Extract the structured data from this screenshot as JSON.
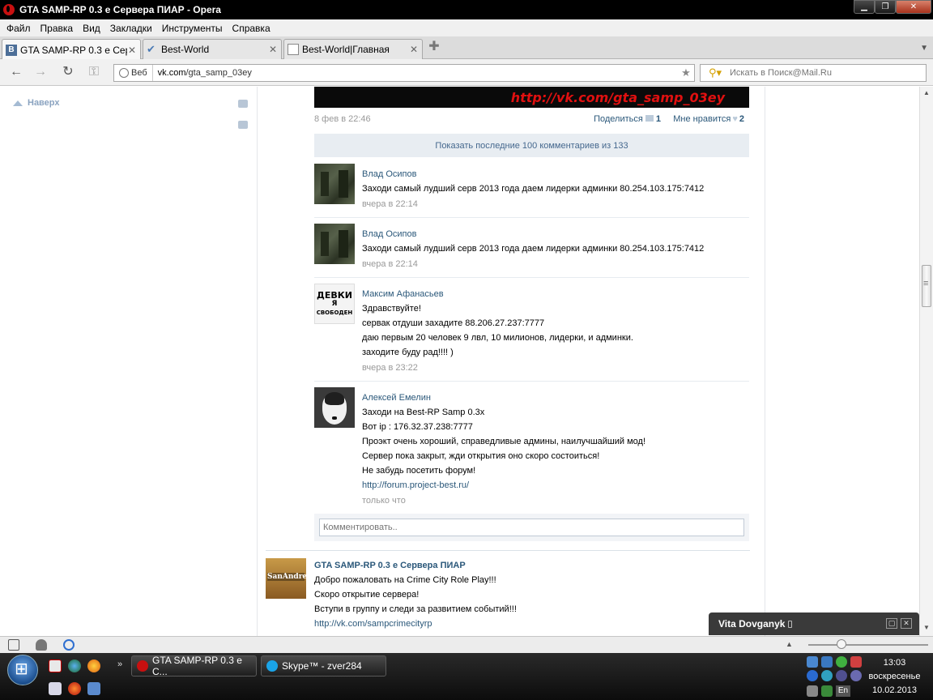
{
  "window": {
    "title": "GTA SAMP-RP 0.3 e Сервера ПИАР - Opera",
    "min_icon": "minimize-icon",
    "max_icon": "maximize-icon",
    "close_icon": "close-icon"
  },
  "menu": [
    "Файл",
    "Правка",
    "Вид",
    "Закладки",
    "Инструменты",
    "Справка"
  ],
  "tabs": [
    {
      "label": "GTA SAMP-RP 0.3 е Сер...",
      "favicon": "vk-favicon",
      "active": true
    },
    {
      "label": "Best-World",
      "favicon": "best-world-favicon",
      "active": false
    },
    {
      "label": "Best-World|Главная",
      "favicon": "page-favicon",
      "active": false
    }
  ],
  "address": {
    "badge": "Веб",
    "url_host": "vk.com",
    "url_path": "/gta_samp_03ey"
  },
  "search": {
    "placeholder": "Искать в Поиск@Mail.Ru"
  },
  "sidebar": {
    "back_to_top": "Наверх"
  },
  "post": {
    "image_link_text": "http://vk.com/gta_samp_03ey",
    "date": "8 фев в 22:46",
    "share_label": "Поделиться",
    "share_count": "1",
    "like_label": "Мне нравится",
    "like_count": "2",
    "show_all": "Показать последние 100 комментариев из 133"
  },
  "comments": [
    {
      "author": "Влад Осипов",
      "lines": [
        "Заходи самый лудший серв 2013 года даем лидерки админки 80.254.103.175:7412"
      ],
      "time": "вчера в 22:14"
    },
    {
      "author": "Влад Осипов",
      "lines": [
        "Заходи самый лудший серв 2013 года даем лидерки админки 80.254.103.175:7412"
      ],
      "time": "вчера в 22:14"
    },
    {
      "author": "Максим Афанасьев",
      "avatar_text": [
        "ДЕВКИ",
        "Я",
        "СВОБОДЕН"
      ],
      "lines": [
        "Здравствуйте!",
        "сервак отдуши захадите 88.206.27.237:7777",
        "даю первым 20 человек 9 лвл, 10 милионов, лидерки, и админки.",
        "заходите буду рад!!!! )"
      ],
      "time": "вчера в 23:22"
    },
    {
      "author": "Алексей Емелин",
      "lines": [
        "Заходи на Best-RP Samp 0.3x",
        "Вот ip : 176.32.37.238:7777",
        "Проэкт очень хороший, справедливые админы, наилучшайший мод!",
        "Сервер пока закрыт, жди открытия оно скоро состоиться!",
        "Не забудь посетить форум!"
      ],
      "link": "http://forum.project-best.ru/",
      "time": "только что"
    }
  ],
  "comment_input": {
    "placeholder": "Комментировать.."
  },
  "post2": {
    "avatar_text": "SanAndreas",
    "group_name": "GTA SAMP-RP 0.3 е Сервера ПИАР",
    "lines": [
      "Добро пожаловать на Crime City Role Play!!!",
      "Скоро открытие сервера!",
      "Вступи в группу и следи за развитием событий!!!"
    ],
    "link": "http://vk.com/sampcrimecityrp"
  },
  "chat": {
    "name": "Vita Dovganyk"
  },
  "taskbar": {
    "items": [
      {
        "label": "GTA SAMP-RP 0.3 e C...",
        "icon": "opera-icon"
      },
      {
        "label": "Skype™ - zver284",
        "icon": "skype-icon"
      }
    ],
    "clock_time": "13:03",
    "clock_day": "воскресенье",
    "clock_date": "10.02.2013",
    "lang": "En"
  },
  "colors": {
    "vk_link": "#2b587a",
    "vk_bar": "#e8edf2",
    "image_link": "#e01010"
  }
}
